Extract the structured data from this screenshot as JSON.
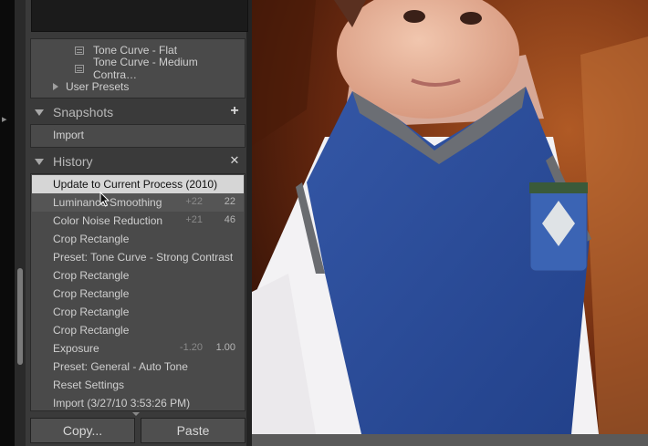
{
  "presets": {
    "items": [
      {
        "label": "Tone Curve - Flat"
      },
      {
        "label": "Tone Curve - Medium Contra…"
      }
    ],
    "folder": "User Presets"
  },
  "snapshots": {
    "title": "Snapshots",
    "add_icon": "plus-icon",
    "items": [
      "Import"
    ]
  },
  "history": {
    "title": "History",
    "clear_icon": "close-icon",
    "items": [
      {
        "label": "Update to Current Process (2010)",
        "delta": "",
        "value": "",
        "selected": true
      },
      {
        "label": "Luminance Smoothing",
        "delta": "+22",
        "value": "22"
      },
      {
        "label": "Color Noise Reduction",
        "delta": "+21",
        "value": "46"
      },
      {
        "label": "Crop Rectangle",
        "delta": "",
        "value": ""
      },
      {
        "label": "Preset: Tone Curve - Strong Contrast",
        "delta": "",
        "value": ""
      },
      {
        "label": "Crop Rectangle",
        "delta": "",
        "value": ""
      },
      {
        "label": "Crop Rectangle",
        "delta": "",
        "value": ""
      },
      {
        "label": "Crop Rectangle",
        "delta": "",
        "value": ""
      },
      {
        "label": "Crop Rectangle",
        "delta": "",
        "value": ""
      },
      {
        "label": "Exposure",
        "delta": "-1.20",
        "value": "1.00"
      },
      {
        "label": "Preset: General - Auto Tone",
        "delta": "",
        "value": ""
      },
      {
        "label": "Reset Settings",
        "delta": "",
        "value": ""
      },
      {
        "label": "Import (3/27/10 3:53:26 PM)",
        "delta": "",
        "value": ""
      }
    ]
  },
  "buttons": {
    "copy": "Copy...",
    "paste": "Paste"
  },
  "colors": {
    "panel": "#3a3a3a",
    "selected_row": "#d6d6d6"
  }
}
